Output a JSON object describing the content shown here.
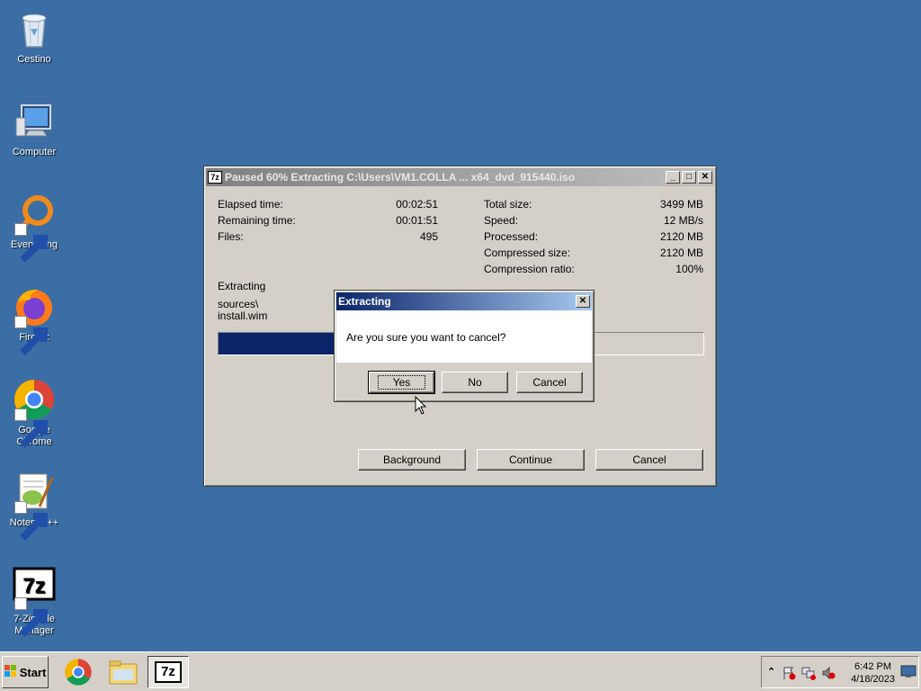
{
  "desktop": {
    "icons": [
      {
        "label": "Cestino",
        "icon": "recycle-bin-icon"
      },
      {
        "label": "Computer",
        "icon": "computer-icon"
      },
      {
        "label": "Everything",
        "icon": "everything-search-icon"
      },
      {
        "label": "Firefox",
        "icon": "firefox-icon"
      },
      {
        "label": "Google Chrome",
        "icon": "chrome-icon"
      },
      {
        "label": "Notepad++",
        "icon": "notepadpp-icon"
      },
      {
        "label": "7-Zip File Manager",
        "icon": "sevenzip-icon"
      }
    ]
  },
  "progress_window": {
    "title": "Paused 60% Extracting C:\\Users\\VM1.COLLA ... x64_dvd_915440.iso",
    "title_icon": "7z",
    "stats_left": [
      {
        "label": "Elapsed time:",
        "value": "00:02:51"
      },
      {
        "label": "Remaining time:",
        "value": "00:01:51"
      },
      {
        "label": "Files:",
        "value": "495"
      }
    ],
    "stats_right": [
      {
        "label": "Total size:",
        "value": "3499 MB"
      },
      {
        "label": "Speed:",
        "value": "12 MB/s"
      },
      {
        "label": "Processed:",
        "value": "2120 MB"
      },
      {
        "label": "Compressed size:",
        "value": "2120 MB"
      },
      {
        "label": "Compression ratio:",
        "value": "100%"
      }
    ],
    "status_label": "Extracting",
    "current_path": "sources\\",
    "current_file": "install.wim",
    "progress_fraction": 0.6,
    "buttons": {
      "background": "Background",
      "continue": "Continue",
      "cancel": "Cancel"
    }
  },
  "confirm_dialog": {
    "title": "Extracting",
    "message": "Are you sure you want to cancel?",
    "buttons": {
      "yes": "Yes",
      "no": "No",
      "cancel": "Cancel"
    }
  },
  "taskbar": {
    "start_label": "Start",
    "sevenzip_label": "7z",
    "clock_time": "6:42 PM",
    "clock_date": "4/18/2023"
  },
  "colors": {
    "desktop": "#3a6ea5",
    "progress_fill": "#0a246a",
    "active_title": "#0a246a"
  }
}
